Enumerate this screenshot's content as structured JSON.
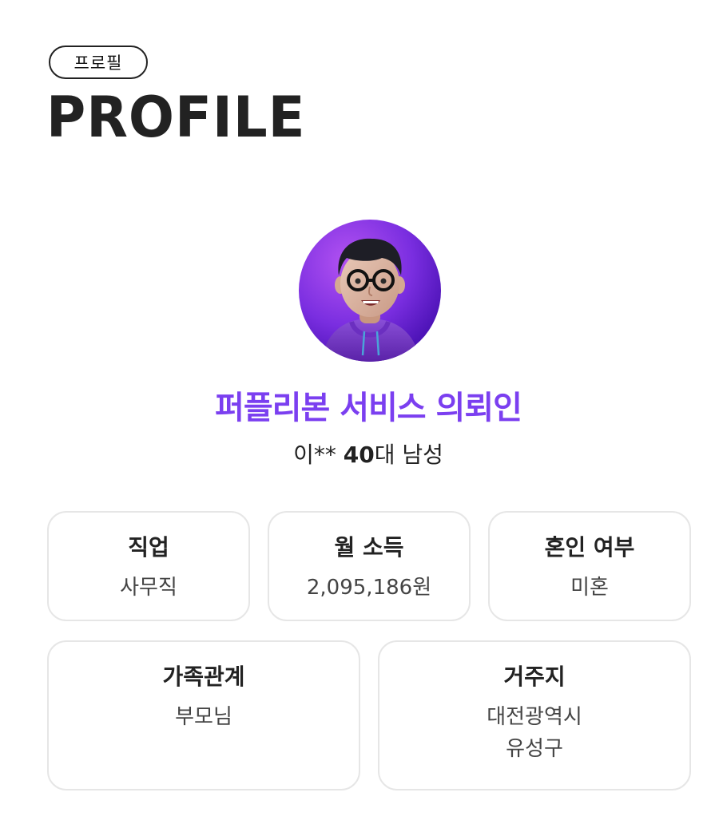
{
  "header": {
    "tag": "프로필",
    "title": "PROFILE"
  },
  "profile": {
    "name": "퍼플리본 서비스 의뢰인",
    "masked_name": "이**",
    "age_group": "40",
    "age_suffix": "대",
    "gender": "남성"
  },
  "cards": {
    "job": {
      "label": "직업",
      "value": "사무직"
    },
    "income": {
      "label": "월 소득",
      "value": "2,095,186원"
    },
    "marriage": {
      "label": "혼인 여부",
      "value": "미혼"
    },
    "family": {
      "label": "가족관계",
      "value": "부모님"
    },
    "residence": {
      "label": "거주지",
      "value_line1": "대전광역시",
      "value_line2": "유성구"
    }
  },
  "colors": {
    "accent": "#7b3ff0",
    "avatar_bg_light": "#a54cf0",
    "avatar_bg_dark": "#4b12b5",
    "card_border": "#e6e6e6"
  }
}
